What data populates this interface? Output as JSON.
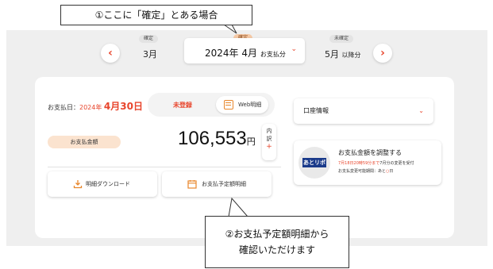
{
  "callouts": {
    "first": "①ここに「確定」とある場合",
    "second_line1": "②お支払予定額明細から",
    "second_line2": "確認いただけます"
  },
  "month_nav": {
    "prev": {
      "badge": "確定",
      "month": "3月"
    },
    "current": {
      "badge": "確定",
      "year_month": "2024年 4月",
      "suffix": "お支払分"
    },
    "next": {
      "badge": "未確定",
      "month": "5月",
      "suffix": "以降分"
    }
  },
  "payment": {
    "due_prefix": "お支払日：",
    "due_year": "2024年",
    "due_month_day": "4月30日",
    "status": "未登録",
    "web_statement": "Web明細",
    "amount_label": "お支払金額",
    "amount": "106,553",
    "currency": "円",
    "breakdown": "内訳",
    "breakdown_plus": "+"
  },
  "actions": {
    "download": "明細ダウンロード",
    "schedule": "お支払予定額明細"
  },
  "account": {
    "label": "口座情報"
  },
  "atoribo": {
    "logo": "あとリボ",
    "title": "お支払金額を調整する",
    "deadline_red": "7月18日20時59分まで",
    "deadline_rest": "7月分の変更を受付",
    "remaining_label": "お支払変更可能期間：あと",
    "remaining_value": "○",
    "remaining_unit": "日"
  },
  "colors": {
    "accent": "#e8452c",
    "badge_orange": "#f5c9a6",
    "panel_bg": "#efefef"
  }
}
